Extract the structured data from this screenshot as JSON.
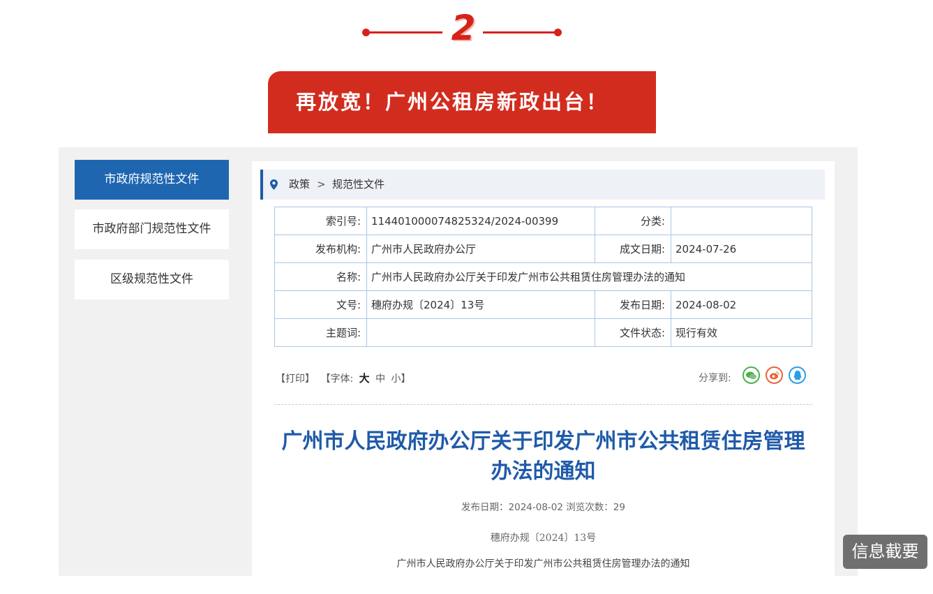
{
  "section": {
    "number": "2"
  },
  "banner": {
    "title": "再放宽！广州公租房新政出台！"
  },
  "sidebar": {
    "items": [
      {
        "label": "市政府规范性文件",
        "active": true
      },
      {
        "label": "市政府部门规范性文件",
        "active": false
      },
      {
        "label": "区级规范性文件",
        "active": false
      }
    ]
  },
  "breadcrumb": {
    "items": [
      "政策",
      "规范性文件"
    ],
    "separator": ">"
  },
  "meta": {
    "index_label": "索引号:",
    "index_value": "114401000074825324/2024-00399",
    "category_label": "分类:",
    "category_value": "",
    "issuer_label": "发布机构:",
    "issuer_value": "广州市人民政府办公厅",
    "written_label": "成文日期:",
    "written_value": "2024-07-26",
    "name_label": "名称:",
    "name_value": "广州市人民政府办公厅关于印发广州市公共租赁住房管理办法的通知",
    "docno_label": "文号:",
    "docno_value": "穗府办规〔2024〕13号",
    "pubdate_label": "发布日期:",
    "pubdate_value": "2024-08-02",
    "keywords_label": "主题词:",
    "keywords_value": "",
    "status_label": "文件状态:",
    "status_value": "现行有效"
  },
  "tools": {
    "print": "【打印】",
    "font_prefix": "【字体:",
    "font_large": "大",
    "font_medium": "中",
    "font_small": "小】",
    "share_label": "分享到:"
  },
  "share_icons": [
    "wechat-icon",
    "weibo-icon",
    "qq-icon"
  ],
  "article": {
    "title_line1": "广州市人民政府办公厅关于印发广州市公共租赁住房管理",
    "title_line2": "办法的通知",
    "info": "发布日期：2024-08-02  浏览次数：29",
    "doc_no": "穗府办规〔2024〕13号",
    "body_title": "广州市人民政府办公厅关于印发广州市公共租赁住房管理办法的通知"
  },
  "badge": {
    "label": "信息截要"
  },
  "colors": {
    "accent_red": "#d22c1f",
    "gov_blue": "#1f5aa8"
  }
}
